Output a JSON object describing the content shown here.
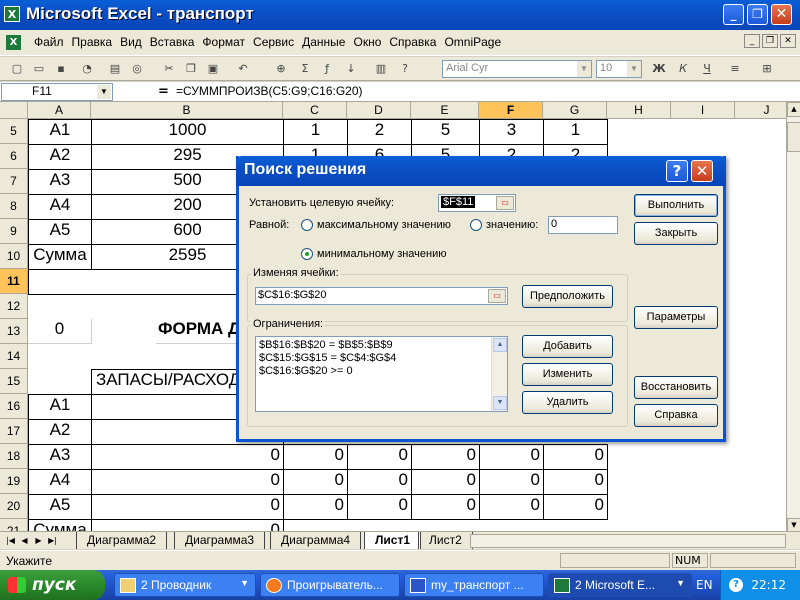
{
  "window": {
    "title": "Microsoft Excel - транспорт",
    "app_icon": "excel-icon"
  },
  "menu": {
    "items": [
      "Файл",
      "Правка",
      "Вид",
      "Вставка",
      "Формат",
      "Сервис",
      "Данные",
      "Окно",
      "Справка",
      "OmniPage"
    ]
  },
  "toolbar": {
    "font_name": "Arial Cyr",
    "font_size": "10"
  },
  "formula_bar": {
    "cell_ref": "F11",
    "equals": "=",
    "formula": "=СУММПРОИЗВ(C5:G9;C16:G20)"
  },
  "grid": {
    "columns": [
      "A",
      "B",
      "C",
      "D",
      "E",
      "F",
      "G",
      "H",
      "I",
      "J"
    ],
    "rows": [
      "5",
      "6",
      "7",
      "8",
      "9",
      "10",
      "11",
      "12",
      "13",
      "14",
      "15",
      "16",
      "17",
      "18",
      "19",
      "20",
      "21"
    ],
    "r5": {
      "a": "A1",
      "b": "1000",
      "c": "1",
      "d": "2",
      "e": "5",
      "f": "3",
      "g": "1"
    },
    "r6": {
      "a": "A2",
      "b": "295",
      "c": "1",
      "d": "6",
      "e": "5",
      "f": "2",
      "g": "2"
    },
    "r7": {
      "a": "A3",
      "b": "500"
    },
    "r8": {
      "a": "A4",
      "b": "200"
    },
    "r9": {
      "a": "A5",
      "b": "600"
    },
    "r10": {
      "a": "Сумма",
      "b": "2595"
    },
    "r13": {
      "a": "0",
      "b": "ФОРМА ДЛЯ ВЫЧИСЛЕНИЙ"
    },
    "r15": {
      "b": "ЗАПАСЫ/РАСХОД"
    },
    "r16": {
      "a": "A1"
    },
    "r17": {
      "a": "A2"
    },
    "r18": {
      "a": "A3",
      "b": "0",
      "c": "0",
      "d": "0",
      "e": "0",
      "f": "0",
      "g": "0"
    },
    "r19": {
      "a": "A4",
      "b": "0",
      "c": "0",
      "d": "0",
      "e": "0",
      "f": "0",
      "g": "0"
    },
    "r20": {
      "a": "A5",
      "b": "0",
      "c": "0",
      "d": "0",
      "e": "0",
      "f": "0",
      "g": "0"
    },
    "r21": {
      "a": "Сумма",
      "b": "0"
    }
  },
  "sheet_tabs": [
    "Диаграмма2",
    "Диаграмма3",
    "Диаграмма4",
    "Лист1",
    "Лист2"
  ],
  "active_tab": "Лист1",
  "status": {
    "text": "Укажите",
    "num": "NUM"
  },
  "solver": {
    "title": "Поиск решения",
    "target_label": "Установить целевую ячейку:",
    "target_value": "$F$11",
    "equal_label": "Равной:",
    "opt_max": "максимальному значению",
    "opt_value": "значению:",
    "opt_value_input": "0",
    "opt_min": "минимальному значению",
    "changing_label": "Изменяя ячейки:",
    "changing_value": "$C$16:$G$20",
    "guess_btn": "Предположить",
    "constraints_label": "Ограничения:",
    "constraints": [
      "$B$16:$B$20 = $B$5:$B$9",
      "$C$15:$G$15 = $C$4:$G$4",
      "$C$16:$G$20 >= 0"
    ],
    "add_btn": "Добавить",
    "change_btn": "Изменить",
    "delete_btn": "Удалить",
    "solve_btn": "Выполнить",
    "close_btn": "Закрыть",
    "options_btn": "Параметры",
    "reset_btn": "Восстановить",
    "help_btn": "Справка"
  },
  "taskbar": {
    "start": "пуск",
    "tasks": [
      "2 Проводник",
      "Проигрыватель...",
      "my_транспорт ...",
      "2 Microsoft E..."
    ],
    "lang": "EN",
    "clock": "22:12"
  }
}
